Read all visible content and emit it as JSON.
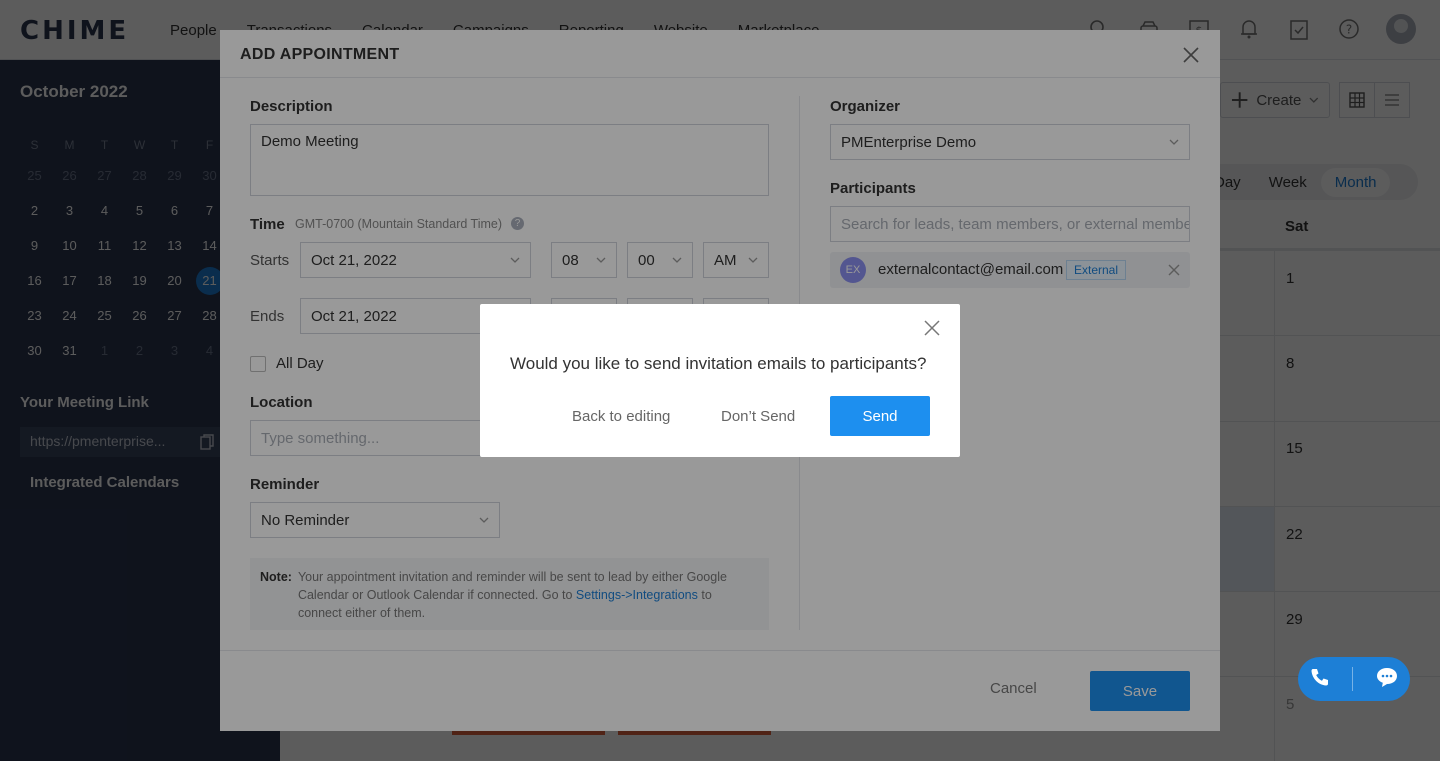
{
  "app": {
    "logo": "CHIME"
  },
  "nav": {
    "items": [
      "People",
      "Transactions",
      "Calendar",
      "Campaigns",
      "Reporting",
      "Website",
      "Marketplace"
    ]
  },
  "top_icons": [
    "search-icon",
    "car-icon",
    "dollar-icon",
    "bell-icon",
    "clipboard-check-icon",
    "help-icon"
  ],
  "sidebar": {
    "month_title": "October 2022",
    "weekdays": [
      "S",
      "M",
      "T",
      "W",
      "T",
      "F"
    ],
    "weeks": [
      [
        "25",
        "26",
        "27",
        "28",
        "29",
        "30"
      ],
      [
        "2",
        "3",
        "4",
        "5",
        "6",
        "7"
      ],
      [
        "9",
        "10",
        "11",
        "12",
        "13",
        "14"
      ],
      [
        "16",
        "17",
        "18",
        "19",
        "20",
        "21"
      ],
      [
        "23",
        "24",
        "25",
        "26",
        "27",
        "28"
      ],
      [
        "30",
        "31",
        "1",
        "2",
        "3",
        "4"
      ]
    ],
    "selected_day": "21",
    "meeting_link_title": "Your Meeting Link",
    "meeting_link": "https://pmenterprise...",
    "integrated_calendars": "Integrated Calendars"
  },
  "calendar": {
    "create_label": "Create",
    "views": [
      "Day",
      "Week",
      "Month"
    ],
    "active_view": "Month",
    "sat_header": "Sat",
    "sat_days": [
      "1",
      "8",
      "15",
      "22",
      "29",
      "5"
    ]
  },
  "modal": {
    "title": "ADD APPOINTMENT",
    "description_label": "Description",
    "description_value": "Demo Meeting",
    "time_label": "Time",
    "timezone": "GMT-0700 (Mountain Standard Time)",
    "starts_label": "Starts",
    "starts_date": "Oct 21, 2022",
    "starts_hour": "08",
    "starts_minute": "00",
    "starts_ampm": "AM",
    "ends_label": "Ends",
    "ends_date": "Oct 21, 2022",
    "all_day_label": "All Day",
    "location_label": "Location",
    "location_placeholder": "Type something...",
    "reminder_label": "Reminder",
    "reminder_value": "No Reminder",
    "note_label": "Note:",
    "note_text": "Your appointment invitation and reminder will be sent to lead by either Google Calendar or Outlook Calendar if connected. Go to",
    "note_link": "Settings->Integrations",
    "note_tail": "to connect either of them.",
    "organizer_label": "Organizer",
    "organizer_value": "PMEnterprise Demo",
    "participants_label": "Participants",
    "participants_placeholder": "Search for leads, team members, or external members",
    "participant": {
      "initials": "EX",
      "email": "externalcontact@email.com",
      "tag": "External"
    },
    "cancel_label": "Cancel",
    "save_label": "Save"
  },
  "dialog": {
    "message": "Would you like to send invitation emails to participants?",
    "back_label": "Back to editing",
    "dont_send_label": "Don’t Send",
    "send_label": "Send"
  },
  "colors": {
    "accent": "#1d8fef",
    "sidebar": "#2a3650",
    "overlay": "rgba(0,0,0,0.4)"
  }
}
